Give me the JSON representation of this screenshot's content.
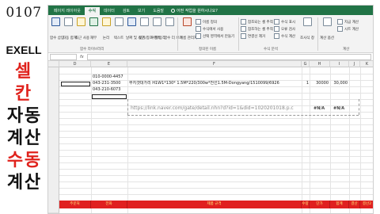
{
  "title_panel": {
    "number": "0107",
    "app": "EXELL",
    "chars": [
      {
        "text": "셀",
        "color": "red"
      },
      {
        "text": "칸",
        "color": "red"
      },
      {
        "text": "자",
        "color": "black"
      },
      {
        "text": "동",
        "color": "black"
      },
      {
        "text": "계",
        "color": "black"
      },
      {
        "text": "산",
        "color": "black"
      },
      {
        "text": "수",
        "color": "red"
      },
      {
        "text": "동",
        "color": "red"
      },
      {
        "text": "계",
        "color": "black"
      },
      {
        "text": "산",
        "color": "black"
      }
    ]
  },
  "ribbon_tabs": [
    "페이지 레이아웃",
    "수식",
    "데이터",
    "검토",
    "보기",
    "도움말"
  ],
  "active_tab": "수식",
  "search": {
    "text": "어떤 작업을 원하시나요?"
  },
  "ribbon": {
    "big_buttons": [
      {
        "label": "함수 삽입",
        "icon": "function-insert-icon"
      },
      {
        "label": "자동 합계",
        "icon": "autosum-icon"
      },
      {
        "label": "최근 사용",
        "icon": "recent-icon"
      },
      {
        "label": "재무",
        "icon": "finance-icon"
      },
      {
        "label": "논리",
        "icon": "logic-icon"
      },
      {
        "label": "텍스트",
        "icon": "text-icon"
      },
      {
        "label": "날짜 및 시간",
        "icon": "calendar-icon"
      },
      {
        "label": "찾기/참조 영역",
        "icon": "lookup-icon"
      },
      {
        "label": "수학/삼각",
        "icon": "math-icon"
      },
      {
        "label": "함수 더 보기",
        "icon": "more-functions-icon"
      },
      {
        "label": "이름 관리자",
        "icon": "name-manager-icon"
      }
    ],
    "name_items": [
      "이름 정의",
      "수식에서 사용",
      "선택 영역에서 만들기"
    ],
    "audit_items": [
      "참조되는 셀 추적",
      "참조하는 셀 추적",
      "연결선 제거",
      "수식 표시",
      "오류 검사",
      "수식 계산"
    ],
    "watch_label": "조사식 창",
    "calc_items": [
      "계산 옵션",
      "지금 계산",
      "시트 계산"
    ],
    "group_labels": [
      "함수 라이브러리",
      "정의된 이름",
      "수식 분석",
      "계산"
    ]
  },
  "formula_bar": {
    "name_box": "",
    "fx": "fx",
    "value": ""
  },
  "columns": [
    "D",
    "E",
    "F",
    "G",
    "H",
    "I",
    "J",
    "K"
  ],
  "cells": {
    "e1": "010-0000-4457",
    "e2": "043-231-3500",
    "e3": "043-210-6073",
    "f2": "무지갯대가리 H1W1*130* 1.5M*220/300w*전선1.5M-Dongyang/1510099/6926",
    "g2": "1",
    "h2": "30000",
    "i2": "30,000",
    "link": "https://link.naver.com/gate/detail.nhn?d?id=1&did=1020201018.p.c",
    "err1": "#N/A",
    "err2": "#N/A"
  },
  "header_row": [
    "주문처",
    "전화",
    "제품 규격",
    "수량",
    "단가",
    "합계",
    "결산",
    "결산2"
  ],
  "colors": {
    "accent": "#217346",
    "header_red": "#e02020",
    "header_text": "#ffe97a",
    "title_red": "#e0221c"
  }
}
